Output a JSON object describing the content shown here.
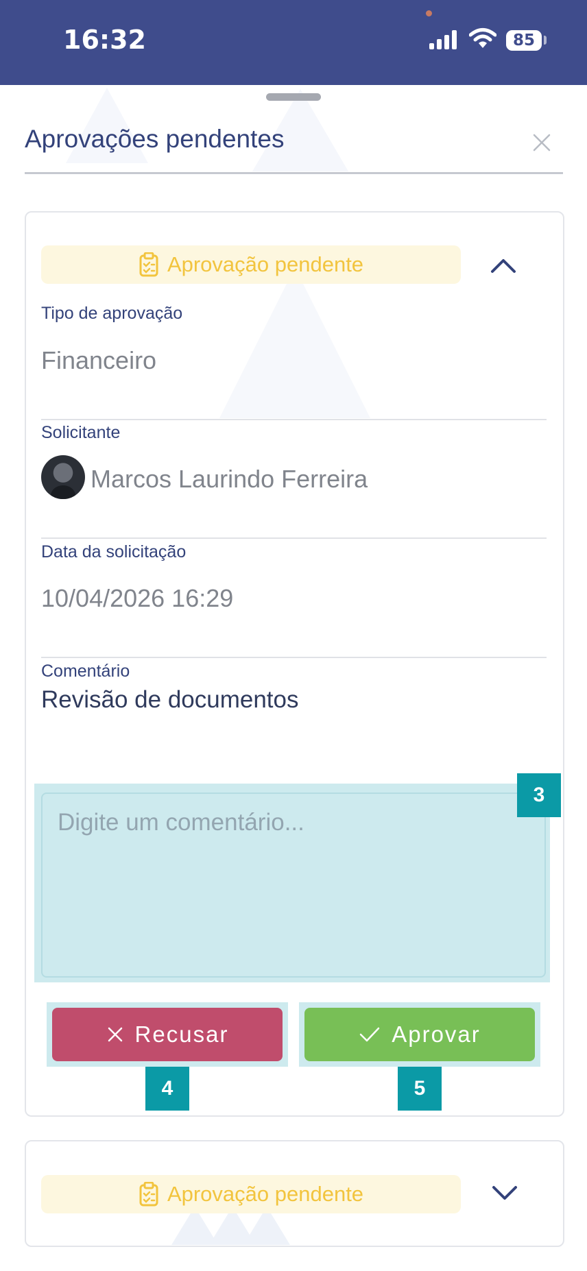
{
  "status_bar": {
    "time": "16:32",
    "battery": "85"
  },
  "sheet": {
    "title": "Aprovações pendentes"
  },
  "approvals": [
    {
      "badge": "Aprovação pendente",
      "expanded": true,
      "fields": {
        "type_label": "Tipo de aprovação",
        "type_value": "Financeiro",
        "requester_label": "Solicitante",
        "requester_value": "Marcos Laurindo Ferreira",
        "date_label": "Data da solicitação",
        "date_value": "10/04/2026 16:29",
        "comment_label": "Comentário",
        "comment_value": "Revisão de documentos"
      },
      "comment_input": {
        "placeholder": "Digite um comentário...",
        "value": ""
      },
      "reject_label": "Recusar",
      "approve_label": "Aprovar"
    },
    {
      "badge": "Aprovação pendente",
      "expanded": false
    }
  ],
  "annotation_markers": [
    "3",
    "4",
    "5"
  ],
  "colors": {
    "status_bar": "#3f4c8c",
    "badge_text": "#f2c43e",
    "badge_bg": "#fdf7df",
    "reject": "#c04d6c",
    "approve": "#78bf56",
    "marker": "#0b9aa6",
    "highlight": "#cdeaee"
  },
  "icons": {
    "badge": "clipboard-check-icon",
    "collapse": "chevron-up-icon",
    "expand": "chevron-down-icon",
    "close": "close-icon",
    "reject": "x-icon",
    "approve": "check-icon"
  }
}
